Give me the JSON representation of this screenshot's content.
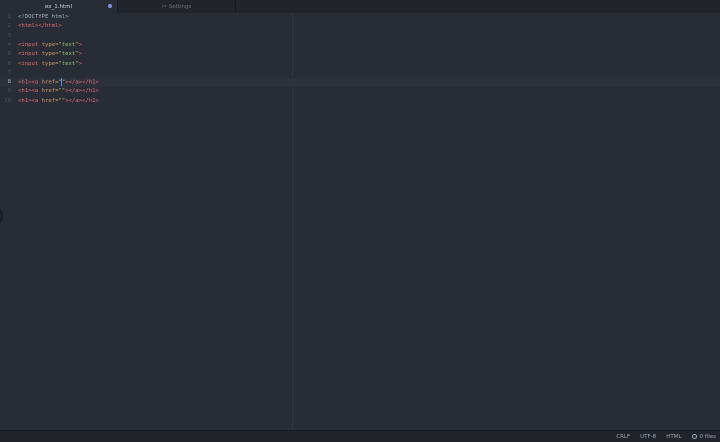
{
  "tabs": [
    {
      "label": "ex_1.html",
      "active": true,
      "modified": true
    },
    {
      "label": "Settings",
      "active": false,
      "icon": "tools-icon"
    }
  ],
  "editor": {
    "lines": [
      {
        "num": "1",
        "parts": [
          {
            "t": "punct",
            "v": "<!DOCTYPE html>"
          }
        ]
      },
      {
        "num": "2",
        "parts": [
          {
            "t": "tag",
            "v": "<html></html>"
          }
        ]
      },
      {
        "num": "3",
        "parts": []
      },
      {
        "num": "4",
        "parts": [
          {
            "t": "tag",
            "v": "<input"
          },
          {
            "t": "punct",
            "v": " "
          },
          {
            "t": "attr",
            "v": "type="
          },
          {
            "t": "str",
            "v": "\"text\""
          },
          {
            "t": "tag",
            "v": ">"
          }
        ]
      },
      {
        "num": "5",
        "parts": [
          {
            "t": "tag",
            "v": "<input"
          },
          {
            "t": "punct",
            "v": " "
          },
          {
            "t": "attr",
            "v": "type="
          },
          {
            "t": "str",
            "v": "\"text\""
          },
          {
            "t": "tag",
            "v": ">"
          }
        ]
      },
      {
        "num": "6",
        "parts": [
          {
            "t": "tag",
            "v": "<input"
          },
          {
            "t": "punct",
            "v": " "
          },
          {
            "t": "attr",
            "v": "type="
          },
          {
            "t": "str",
            "v": "\"text\""
          },
          {
            "t": "tag",
            "v": ">"
          }
        ]
      },
      {
        "num": "7",
        "parts": []
      },
      {
        "num": "8",
        "cursor": true,
        "parts": [
          {
            "t": "tag",
            "v": "<h1><a"
          },
          {
            "t": "punct",
            "v": " "
          },
          {
            "t": "attr",
            "v": "href="
          },
          {
            "t": "str",
            "v": "\""
          },
          {
            "t": "caret",
            "v": ""
          },
          {
            "t": "str",
            "v": "\""
          },
          {
            "t": "tag",
            "v": "></a></h1>"
          }
        ]
      },
      {
        "num": "9",
        "parts": [
          {
            "t": "tag",
            "v": "<h1><a"
          },
          {
            "t": "punct",
            "v": " "
          },
          {
            "t": "attr",
            "v": "href="
          },
          {
            "t": "str",
            "v": "\"\""
          },
          {
            "t": "tag",
            "v": "></a></h1>"
          }
        ]
      },
      {
        "num": "10",
        "parts": [
          {
            "t": "tag",
            "v": "<h1><a"
          },
          {
            "t": "punct",
            "v": " "
          },
          {
            "t": "attr",
            "v": "href="
          },
          {
            "t": "str",
            "v": "\"\""
          },
          {
            "t": "tag",
            "v": "></a></h1>"
          }
        ]
      }
    ]
  },
  "status": {
    "line_ending": "CRLF",
    "encoding": "UTF-8",
    "grammar": "HTML",
    "files": "0 files"
  },
  "colors": {
    "background": "#282c34",
    "tag": "#e06c75",
    "attr": "#d19a66",
    "string": "#98c379",
    "cursor": "#528bff",
    "modified_dot": "#7c8fe3"
  }
}
